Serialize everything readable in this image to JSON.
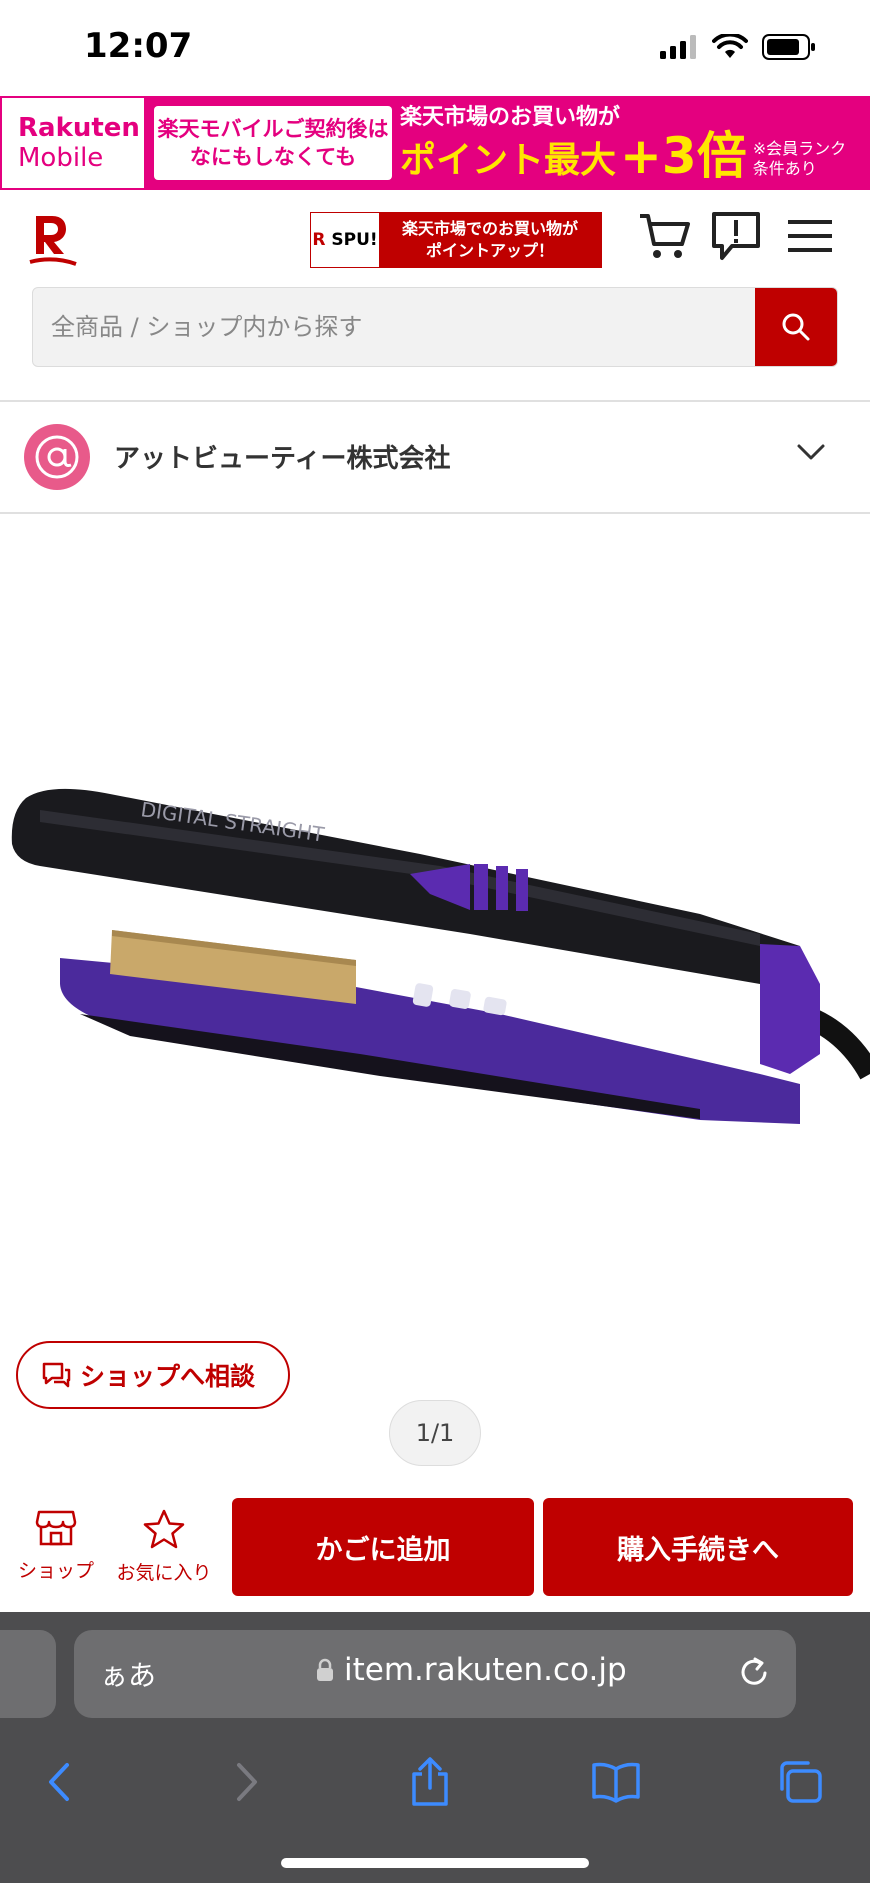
{
  "status_bar": {
    "time": "12:07"
  },
  "promo": {
    "logo_line1": "Rakuten",
    "logo_line2": "Mobile",
    "left_line1": "楽天モバイルご契約後は",
    "left_line2": "なにもしなくても",
    "right_top": "楽天市場のお買い物が",
    "right_big": "ポイント最大",
    "right_plus": "+3倍",
    "right_note1": "※会員ランク",
    "right_note2": "条件あり"
  },
  "header": {
    "spu_badge": "SPU!",
    "spu_line1": "楽天市場でのお買い物が",
    "spu_line2": "ポイントアップ！"
  },
  "search": {
    "placeholder": "全商品 / ショップ内から探す"
  },
  "shop": {
    "name": "アットビューティー株式会社",
    "avatar_text": "@"
  },
  "product": {
    "brand_text": "DIGITAL STRAIGHT"
  },
  "consult": {
    "label": "ショップへ相談"
  },
  "pager": {
    "text": "1/1"
  },
  "actions": {
    "shop_label": "ショップ",
    "favorite_label": "お気に入り",
    "add_cart_label": "かごに追加",
    "checkout_label": "購入手続きへ"
  },
  "browser": {
    "aa_label": "ぁあ",
    "url": "item.rakuten.co.jp"
  },
  "colors": {
    "rakuten_red": "#bf0000",
    "promo_pink": "#e4007f",
    "promo_yellow": "#ffe600",
    "iron_purple": "#5b2bb0"
  }
}
